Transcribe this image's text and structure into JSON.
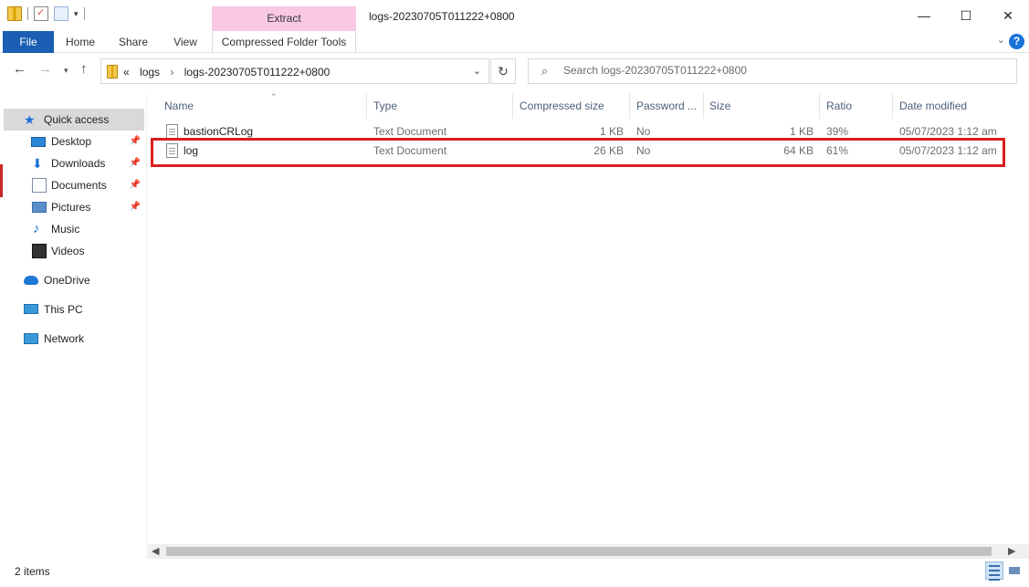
{
  "window": {
    "title": "logs-20230705T011222+0800",
    "extract_tab": "Extract",
    "buttons": {
      "minimize": "—",
      "maximize": "☐",
      "close": "✕"
    }
  },
  "ribbon": {
    "tabs": [
      "File",
      "Home",
      "Share",
      "View",
      "Compressed Folder Tools"
    ],
    "help": "?"
  },
  "address": {
    "overflow": "«",
    "crumbs": [
      "logs",
      "logs-20230705T011222+0800"
    ],
    "separator": "›"
  },
  "search": {
    "placeholder": "Search logs-20230705T011222+0800"
  },
  "sidebar": {
    "items": [
      {
        "label": "Quick access",
        "icon": "star-icon",
        "pinned": false
      },
      {
        "label": "Desktop",
        "icon": "desktop-icon",
        "pinned": true
      },
      {
        "label": "Downloads",
        "icon": "download-icon",
        "pinned": true
      },
      {
        "label": "Documents",
        "icon": "documents-icon",
        "pinned": true
      },
      {
        "label": "Pictures",
        "icon": "pictures-icon",
        "pinned": true
      },
      {
        "label": "Music",
        "icon": "music-icon",
        "pinned": false
      },
      {
        "label": "Videos",
        "icon": "videos-icon",
        "pinned": false
      },
      {
        "label": "OneDrive",
        "icon": "onedrive-icon",
        "pinned": false
      },
      {
        "label": "This PC",
        "icon": "this-pc-icon",
        "pinned": false
      },
      {
        "label": "Network",
        "icon": "network-icon",
        "pinned": false
      }
    ]
  },
  "table": {
    "columns": [
      "Name",
      "Type",
      "Compressed size",
      "Password ...",
      "Size",
      "Ratio",
      "Date modified"
    ],
    "rows": [
      {
        "name": "bastionCRLog",
        "type": "Text Document",
        "compressed": "1 KB",
        "password": "No",
        "size": "1 KB",
        "ratio": "39%",
        "date": "05/07/2023 1:12 am"
      },
      {
        "name": "log",
        "type": "Text Document",
        "compressed": "26 KB",
        "password": "No",
        "size": "64 KB",
        "ratio": "61%",
        "date": "05/07/2023 1:12 am"
      }
    ]
  },
  "status": {
    "count": "2 items"
  },
  "colors": {
    "file_tab": "#1a5fb4",
    "extract_tab": "#f8c8e4",
    "highlight": "#d91e1e",
    "selected_nav": "#d9d9d9"
  }
}
